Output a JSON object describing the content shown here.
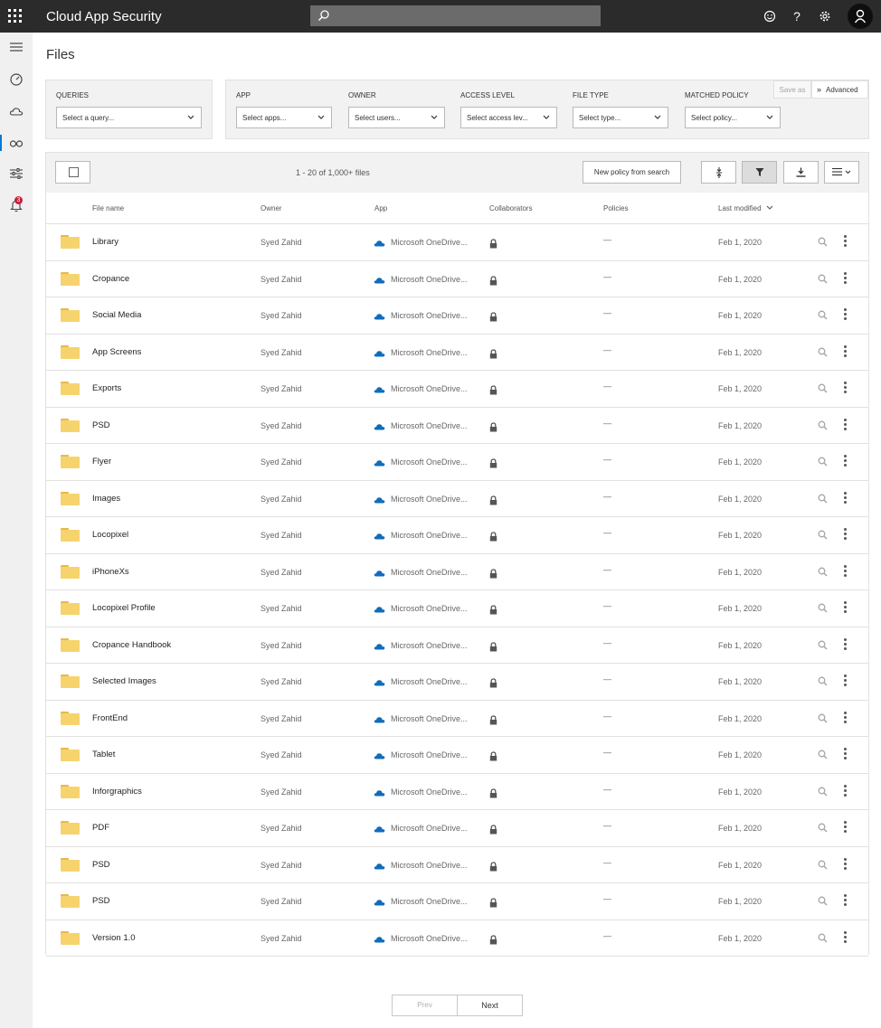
{
  "app": {
    "title": "Cloud App Security",
    "search_placeholder": ""
  },
  "page": {
    "title": "Files"
  },
  "filters": {
    "queries": {
      "label": "QUERIES",
      "placeholder": "Select a query..."
    },
    "fields": [
      {
        "label": "APP",
        "placeholder": "Select apps..."
      },
      {
        "label": "OWNER",
        "placeholder": "Select users..."
      },
      {
        "label": "ACCESS LEVEL",
        "placeholder": "Select access lev..."
      },
      {
        "label": "FILE TYPE",
        "placeholder": "Select type..."
      },
      {
        "label": "MATCHED POLICY",
        "placeholder": "Select policy..."
      }
    ],
    "save_as": "Save as",
    "advanced": "Advanced"
  },
  "toolbar": {
    "count": "1 - 20 of 1,000+ files",
    "new_policy": "New policy from search"
  },
  "table": {
    "columns": [
      "File name",
      "Owner",
      "App",
      "Collaborators",
      "Policies",
      "Last modified"
    ],
    "rows": [
      {
        "name": "Library",
        "owner": "Syed Zahid",
        "app": "Microsoft OneDrive...",
        "policies": "—",
        "modified": "Feb 1, 2020"
      },
      {
        "name": "Cropance",
        "owner": "Syed Zahid",
        "app": "Microsoft OneDrive...",
        "policies": "—",
        "modified": "Feb 1, 2020"
      },
      {
        "name": "Social Media",
        "owner": "Syed Zahid",
        "app": "Microsoft OneDrive...",
        "policies": "—",
        "modified": "Feb 1, 2020"
      },
      {
        "name": "App Screens",
        "owner": "Syed Zahid",
        "app": "Microsoft OneDrive...",
        "policies": "—",
        "modified": "Feb 1, 2020"
      },
      {
        "name": "Exports",
        "owner": "Syed Zahid",
        "app": "Microsoft OneDrive...",
        "policies": "—",
        "modified": "Feb 1, 2020"
      },
      {
        "name": "PSD",
        "owner": "Syed Zahid",
        "app": "Microsoft OneDrive...",
        "policies": "—",
        "modified": "Feb 1, 2020"
      },
      {
        "name": "Flyer",
        "owner": "Syed Zahid",
        "app": "Microsoft OneDrive...",
        "policies": "—",
        "modified": "Feb 1, 2020"
      },
      {
        "name": "Images",
        "owner": "Syed Zahid",
        "app": "Microsoft OneDrive...",
        "policies": "—",
        "modified": "Feb 1, 2020"
      },
      {
        "name": "Locopixel",
        "owner": "Syed Zahid",
        "app": "Microsoft OneDrive...",
        "policies": "—",
        "modified": "Feb 1, 2020"
      },
      {
        "name": "iPhoneXs",
        "owner": "Syed Zahid",
        "app": "Microsoft OneDrive...",
        "policies": "—",
        "modified": "Feb 1, 2020"
      },
      {
        "name": "Locopixel Profile",
        "owner": "Syed Zahid",
        "app": "Microsoft OneDrive...",
        "policies": "—",
        "modified": "Feb 1, 2020"
      },
      {
        "name": "Cropance Handbook",
        "owner": "Syed Zahid",
        "app": "Microsoft OneDrive...",
        "policies": "—",
        "modified": "Feb 1, 2020"
      },
      {
        "name": "Selected Images",
        "owner": "Syed Zahid",
        "app": "Microsoft OneDrive...",
        "policies": "—",
        "modified": "Feb 1, 2020"
      },
      {
        "name": "FrontEnd",
        "owner": "Syed Zahid",
        "app": "Microsoft OneDrive...",
        "policies": "—",
        "modified": "Feb 1, 2020"
      },
      {
        "name": "Tablet",
        "owner": "Syed Zahid",
        "app": "Microsoft OneDrive...",
        "policies": "—",
        "modified": "Feb 1, 2020"
      },
      {
        "name": "Inforgraphics",
        "owner": "Syed Zahid",
        "app": "Microsoft OneDrive...",
        "policies": "—",
        "modified": "Feb 1, 2020"
      },
      {
        "name": "PDF",
        "owner": "Syed Zahid",
        "app": "Microsoft OneDrive...",
        "policies": "—",
        "modified": "Feb 1, 2020"
      },
      {
        "name": "PSD",
        "owner": "Syed Zahid",
        "app": "Microsoft OneDrive...",
        "policies": "—",
        "modified": "Feb 1, 2020"
      },
      {
        "name": "PSD",
        "owner": "Syed Zahid",
        "app": "Microsoft OneDrive...",
        "policies": "—",
        "modified": "Feb 1, 2020"
      },
      {
        "name": "Version 1.0",
        "owner": "Syed Zahid",
        "app": "Microsoft OneDrive...",
        "policies": "—",
        "modified": "Feb 1, 2020"
      }
    ]
  },
  "pagination": {
    "prev": "Prev",
    "next": "Next"
  },
  "notifications": {
    "count": "3"
  },
  "colors": {
    "topbar": "#2b2b2b",
    "accent": "#0078d4",
    "folder": "#f6d36d",
    "onedrive": "#0f6cbd",
    "badge": "#c81e3c"
  }
}
